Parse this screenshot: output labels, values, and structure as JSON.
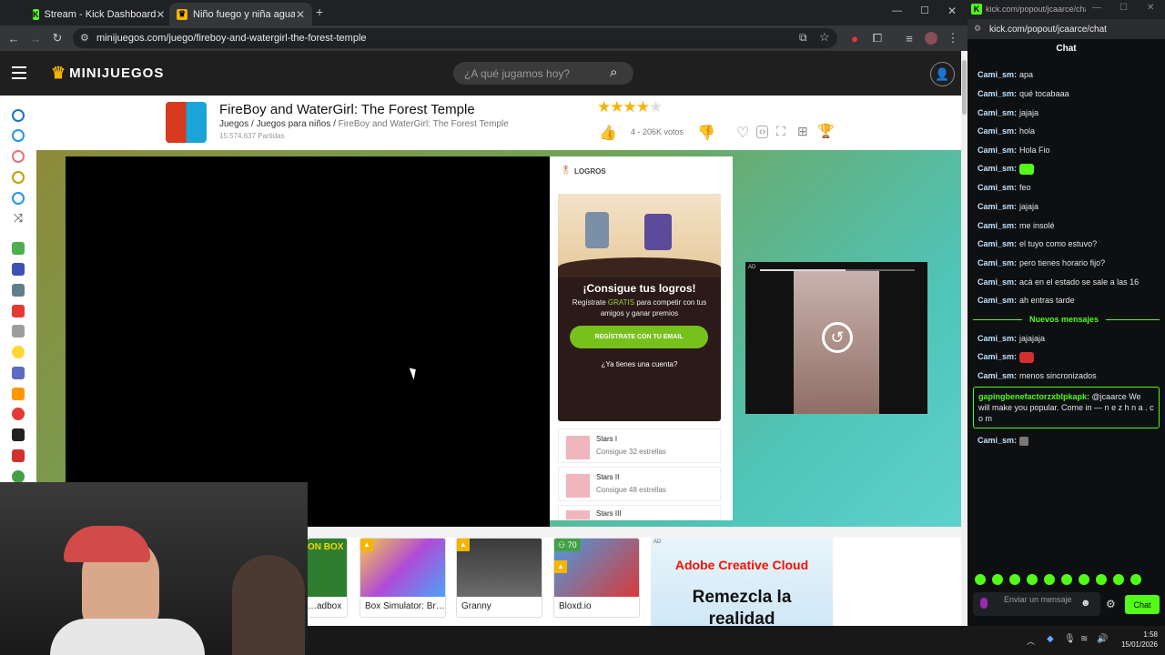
{
  "browser": {
    "tabs": [
      {
        "label": "Stream - Kick Dashboard",
        "active": false
      },
      {
        "label": "Niño fuego y niña agua - Fireb…",
        "active": true
      }
    ],
    "url": "minijuegos.com/juego/fireboy-and-watergirl-the-forest-temple"
  },
  "site": {
    "logo": "MINIJUEGOS",
    "search_placeholder": "¿A qué jugamos hoy?"
  },
  "game": {
    "title": "FireBoy and WaterGirl: The Forest Temple",
    "breadcrumb": [
      "Juegos",
      "Juegos para niños",
      "FireBoy and WaterGirl: The Forest Temple"
    ],
    "plays": "15.574.637 Partidas",
    "rating_stars": 4,
    "votes": "4 - 206K votos"
  },
  "achievements": {
    "header": "LOGROS",
    "promo_title": "¡Consigue tus logros!",
    "promo_text_a": "Regístrate",
    "promo_text_free": "GRATIS",
    "promo_text_b": "para competir con tus amigos y ganar premios",
    "register_button": "REGÍSTRATE CON TU EMAIL",
    "login_link": "¿Ya tienes una cuenta?",
    "items": [
      {
        "name": "Stars I",
        "desc": "Consigue 32 estrellas"
      },
      {
        "name": "Stars II",
        "desc": "Consigue 48 estrellas"
      },
      {
        "name": "Stars III",
        "desc": ""
      }
    ]
  },
  "ad_label": "AD",
  "related": [
    {
      "label": "…adbox",
      "overlay": "ON BOX"
    },
    {
      "label": "Box Simulator: Br…",
      "badge": ""
    },
    {
      "label": "Granny",
      "badge": ""
    },
    {
      "label": "Bloxd.io",
      "badge": "70"
    }
  ],
  "banner": {
    "ad_mark": "AD",
    "brand": "Adobe Creative Cloud",
    "line1": "Remezcla la",
    "line2": "realidad"
  },
  "chat": {
    "url": "kick.com/popout/jcaarce/chat",
    "title": "Chat",
    "messages": [
      {
        "user": "Cami_sm:",
        "text": "apa"
      },
      {
        "user": "Cami_sm:",
        "text": "qué tocabaaa"
      },
      {
        "user": "Cami_sm:",
        "text": "jajaja"
      },
      {
        "user": "Cami_sm:",
        "text": "hola"
      },
      {
        "user": "Cami_sm:",
        "text": "Hola Fio"
      },
      {
        "user": "Cami_sm:",
        "text": ""
      },
      {
        "user": "Cami_sm:",
        "text": "feo"
      },
      {
        "user": "Cami_sm:",
        "text": "jajaja"
      },
      {
        "user": "Cami_sm:",
        "text": "me insolé"
      },
      {
        "user": "Cami_sm:",
        "text": "el tuyo como estuvo?"
      },
      {
        "user": "Cami_sm:",
        "text": "pero tienes horario fijo?"
      },
      {
        "user": "Cami_sm:",
        "text": "acá en el estado se sale a las 16"
      },
      {
        "user": "Cami_sm:",
        "text": "ah entras tarde"
      }
    ],
    "new_messages_label": "Nuevos mensajes",
    "new_messages": [
      {
        "user": "Cami_sm:",
        "text": "jajajaja"
      },
      {
        "user": "Cami_sm:",
        "text": ""
      },
      {
        "user": "Cami_sm:",
        "text": "menos sincronizados"
      }
    ],
    "spam": {
      "user": "gapingbenefactorzxblpkapk:",
      "text": "@jcaarce We will make you popular. Come in — n e z h n a . c o m"
    },
    "last": {
      "user": "Cami_sm:",
      "text": ""
    },
    "input_placeholder": "Enviar un mensaje",
    "send_button": "Chat"
  },
  "taskbar": {
    "time": "1:58",
    "date": "15/01/2026"
  },
  "colors": {
    "kick_green": "#53fc18",
    "site_green": "#77c11c",
    "brand_red": "#fa0f00"
  }
}
